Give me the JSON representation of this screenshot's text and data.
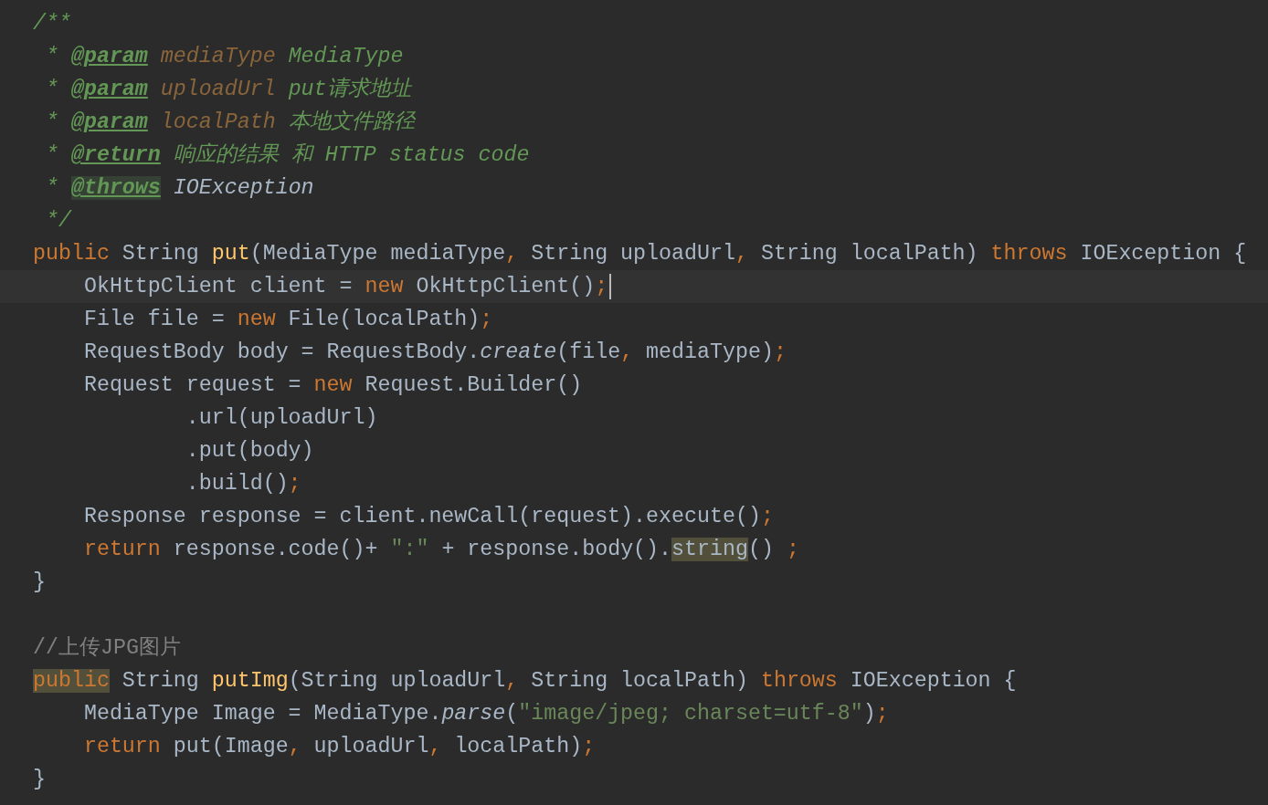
{
  "editor": {
    "lines": [
      {
        "current": false,
        "tokens": [
          {
            "text": "/**",
            "kind": "doc"
          }
        ]
      },
      {
        "current": false,
        "tokens": [
          {
            "text": " * ",
            "kind": "doc"
          },
          {
            "text": "@param",
            "kind": "tag"
          },
          {
            "text": " mediaType",
            "kind": "docparam"
          },
          {
            "text": " MediaType",
            "kind": "doc"
          }
        ]
      },
      {
        "current": false,
        "tokens": [
          {
            "text": " * ",
            "kind": "doc"
          },
          {
            "text": "@param",
            "kind": "tag"
          },
          {
            "text": " uploadUrl",
            "kind": "docparam"
          },
          {
            "text": " put请求地址",
            "kind": "doc"
          }
        ]
      },
      {
        "current": false,
        "tokens": [
          {
            "text": " * ",
            "kind": "doc"
          },
          {
            "text": "@param",
            "kind": "tag"
          },
          {
            "text": " localPath",
            "kind": "docparam"
          },
          {
            "text": " 本地文件路径",
            "kind": "doc"
          }
        ]
      },
      {
        "current": false,
        "tokens": [
          {
            "text": " * ",
            "kind": "doc"
          },
          {
            "text": "@return",
            "kind": "tag"
          },
          {
            "text": " 响应的结果 和 HTTP status code",
            "kind": "doc"
          }
        ]
      },
      {
        "current": false,
        "tokens": [
          {
            "text": " * ",
            "kind": "doc"
          },
          {
            "text": "@throws",
            "kind": "tag",
            "marked": true
          },
          {
            "text": " IOException",
            "kind": "docref"
          }
        ]
      },
      {
        "current": false,
        "tokens": [
          {
            "text": " */",
            "kind": "doc"
          }
        ]
      },
      {
        "current": false,
        "tokens": [
          {
            "text": "public",
            "kind": "keyword"
          },
          {
            "text": " String ",
            "kind": "plain"
          },
          {
            "text": "put",
            "kind": "method"
          },
          {
            "text": "(MediaType mediaType",
            "kind": "plain"
          },
          {
            "text": ",",
            "kind": "punct"
          },
          {
            "text": " String uploadUrl",
            "kind": "plain"
          },
          {
            "text": ",",
            "kind": "punct"
          },
          {
            "text": " String localPath) ",
            "kind": "plain"
          },
          {
            "text": "throws",
            "kind": "keyword"
          },
          {
            "text": " IOException {",
            "kind": "plain"
          }
        ]
      },
      {
        "current": true,
        "tokens": [
          {
            "text": "    OkHttpClient client = ",
            "kind": "plain"
          },
          {
            "text": "new",
            "kind": "keyword"
          },
          {
            "text": " OkHttpClient()",
            "kind": "plain"
          },
          {
            "text": ";",
            "kind": "punct"
          }
        ]
      },
      {
        "current": false,
        "tokens": [
          {
            "text": "    File file = ",
            "kind": "plain"
          },
          {
            "text": "new",
            "kind": "keyword"
          },
          {
            "text": " File(localPath)",
            "kind": "plain"
          },
          {
            "text": ";",
            "kind": "punct"
          }
        ]
      },
      {
        "current": false,
        "tokens": [
          {
            "text": "    RequestBody body = RequestBody.",
            "kind": "plain"
          },
          {
            "text": "create",
            "kind": "italic"
          },
          {
            "text": "(file",
            "kind": "plain"
          },
          {
            "text": ",",
            "kind": "punct"
          },
          {
            "text": " mediaType)",
            "kind": "plain"
          },
          {
            "text": ";",
            "kind": "punct"
          }
        ]
      },
      {
        "current": false,
        "tokens": [
          {
            "text": "    Request request = ",
            "kind": "plain"
          },
          {
            "text": "new",
            "kind": "keyword"
          },
          {
            "text": " Request.Builder()",
            "kind": "plain"
          }
        ]
      },
      {
        "current": false,
        "tokens": [
          {
            "text": "            .url(uploadUrl)",
            "kind": "plain"
          }
        ]
      },
      {
        "current": false,
        "tokens": [
          {
            "text": "            .put(body)",
            "kind": "plain"
          }
        ]
      },
      {
        "current": false,
        "tokens": [
          {
            "text": "            .build()",
            "kind": "plain"
          },
          {
            "text": ";",
            "kind": "punct"
          }
        ]
      },
      {
        "current": false,
        "tokens": [
          {
            "text": "    Response response = client.newCall(request).execute()",
            "kind": "plain"
          },
          {
            "text": ";",
            "kind": "punct"
          }
        ]
      },
      {
        "current": false,
        "tokens": [
          {
            "text": "    return",
            "kind": "keyword"
          },
          {
            "text": " response.code()+ ",
            "kind": "plain"
          },
          {
            "text": "\":\"",
            "kind": "string"
          },
          {
            "text": " + response.body().",
            "kind": "plain"
          },
          {
            "text": "string",
            "kind": "plain",
            "marked": true
          },
          {
            "text": "() ",
            "kind": "plain"
          },
          {
            "text": ";",
            "kind": "punct"
          }
        ]
      },
      {
        "current": false,
        "tokens": [
          {
            "text": "}",
            "kind": "plain"
          }
        ]
      },
      {
        "current": false
      },
      {
        "current": false,
        "tokens": [
          {
            "text": "//上传JPG图片",
            "kind": "linecomment"
          }
        ]
      },
      {
        "current": false,
        "tokens": [
          {
            "text": "public",
            "kind": "keyword",
            "marked": true
          },
          {
            "text": " String ",
            "kind": "plain"
          },
          {
            "text": "putImg",
            "kind": "method"
          },
          {
            "text": "(String uploadUrl",
            "kind": "plain"
          },
          {
            "text": ",",
            "kind": "punct"
          },
          {
            "text": " String localPath) ",
            "kind": "plain"
          },
          {
            "text": "throws",
            "kind": "keyword"
          },
          {
            "text": " IOException {",
            "kind": "plain"
          }
        ]
      },
      {
        "current": false,
        "tokens": [
          {
            "text": "    MediaType Image = MediaType.",
            "kind": "plain"
          },
          {
            "text": "parse",
            "kind": "italic"
          },
          {
            "text": "(",
            "kind": "plain"
          },
          {
            "text": "\"image/jpeg; charset=utf-8\"",
            "kind": "string"
          },
          {
            "text": ")",
            "kind": "plain"
          },
          {
            "text": ";",
            "kind": "punct"
          }
        ]
      },
      {
        "current": false,
        "tokens": [
          {
            "text": "    return",
            "kind": "keyword"
          },
          {
            "text": " put(Image",
            "kind": "plain"
          },
          {
            "text": ",",
            "kind": "punct"
          },
          {
            "text": " uploadUrl",
            "kind": "plain"
          },
          {
            "text": ",",
            "kind": "punct"
          },
          {
            "text": " localPath)",
            "kind": "plain"
          },
          {
            "text": ";",
            "kind": "punct"
          }
        ]
      },
      {
        "current": false,
        "tokens": [
          {
            "text": "}",
            "kind": "plain"
          }
        ]
      }
    ]
  }
}
